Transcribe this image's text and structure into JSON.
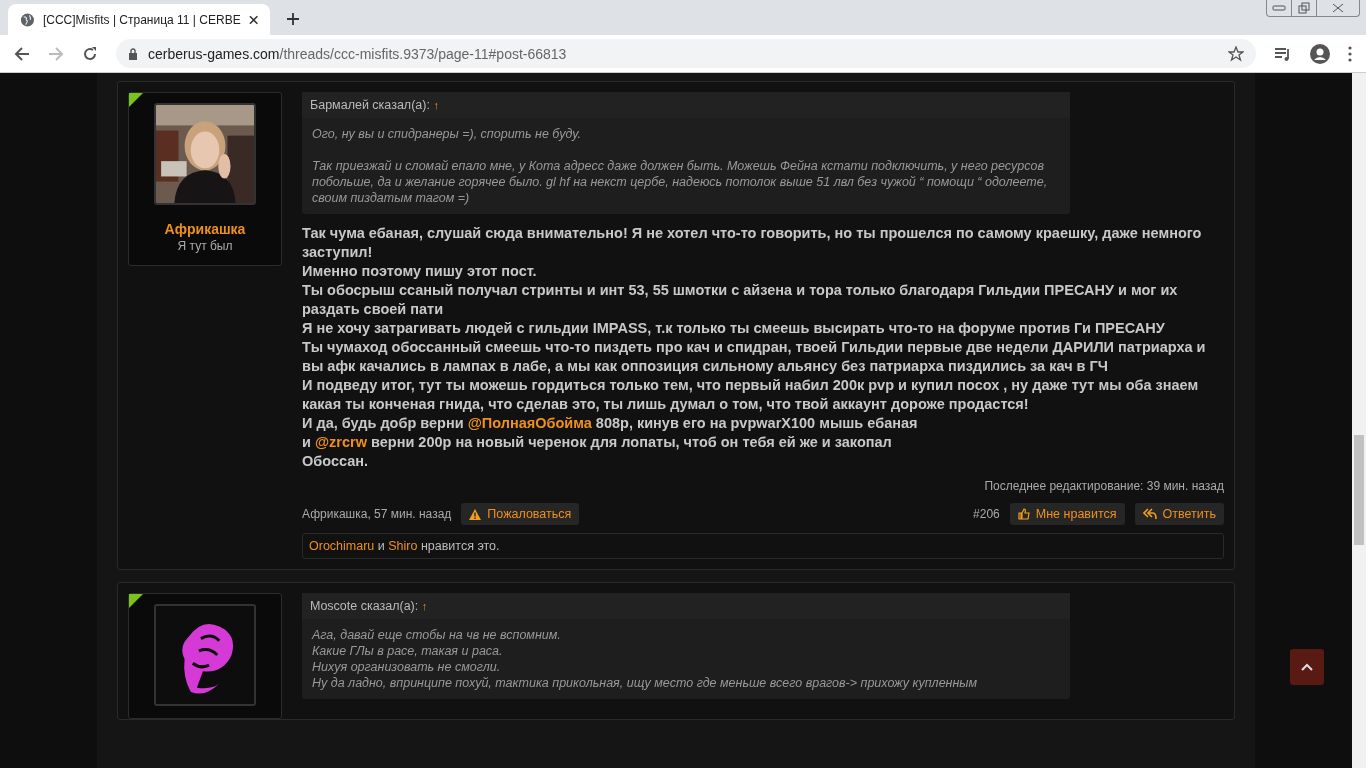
{
  "browser": {
    "tab_title": "[CCC]Misfits | Страница 11 | CERBE",
    "url_host": "cerberus-games.com",
    "url_path": "/threads/ccc-misfits.9373/page-11#post-66813"
  },
  "posts": [
    {
      "kind": "full",
      "author": "Африкашка",
      "user_title": "Я тут был",
      "avatar": {
        "kind": "picture"
      },
      "quote": {
        "author": "Бармалей сказал(а):",
        "arrow": "↑",
        "paragraphs": [
          [
            "Ого, ну вы и спидранеры =), спорить не буду."
          ],
          [
            "Так приезжай и сломай епало мне, у Кота адресс даже должен быть. Можешь Фейна кстати подключить, у него ресурсов побольше, да и желание горячее было. gl hf на некст цербе, надеюсь потолок выше 51 лвл без чужой “ помощи “ одолеете, своим пиздатым тагом =)"
          ]
        ]
      },
      "body": [
        [
          {
            "kind": "text",
            "text": "Так чума ебаная, слушай сюда внимательно! Я не хотел что-то говорить, но ты прошелся по самому краешку, даже немного заступил!"
          }
        ],
        [
          {
            "kind": "text",
            "text": "Именно поэтому пишу этот пост."
          }
        ],
        [
          {
            "kind": "text",
            "text": "Ты обосрыш ссаный получал стринты и инт 53, 55 шмотки с айзена и тора только благодаря Гильдии ПРЕСАНУ и мог их раздать своей пати"
          }
        ],
        [
          {
            "kind": "text",
            "text": "Я не хочу затрагивать людей с гильдии IMPASS, т.к только ты смеешь высирать что-то на форуме против Ги ПРЕСАНУ"
          }
        ],
        [
          {
            "kind": "text",
            "text": "Ты чумаход обоссанный смеешь что-то пиздеть про кач и спидран, твоей Гильдии первые две недели ДАРИЛИ патриарха и вы афк качались в лампах в лабе, а мы как оппозиция сильному альянсу без патриарха пиздились за кач в ГЧ"
          }
        ],
        [
          {
            "kind": "text",
            "text": "И подведу итог, тут ты можешь гордиться только тем, что первый набил 200к pvp и купил посох , ну даже тут мы оба знаем какая ты конченая гнида, что сделав это, ты лишь думал о том, что твой аккаунт дороже продастся!"
          }
        ],
        [
          {
            "kind": "text",
            "text": "И да, будь добр верни "
          },
          {
            "kind": "mention",
            "text": "@ПолнаяОбойма"
          },
          {
            "kind": "text",
            "text": " 808р, кинув его на pvpwarX100 мышь ебаная"
          }
        ],
        [
          {
            "kind": "text",
            "text": "и "
          },
          {
            "kind": "mention",
            "text": "@zrcrw"
          },
          {
            "kind": "text",
            "text": " верни 200р на новый черенок для лопаты, чтоб он тебя ей же и закопал"
          }
        ],
        [
          {
            "kind": "text",
            "text": "Обоссан."
          }
        ]
      ],
      "edited": "Последнее редактирование: 39 мин. назад",
      "meta": "Африкашка, 57 мин. назад",
      "report": "Пожаловаться",
      "number": "#206",
      "like": "Мне нравится",
      "reply": "Ответить",
      "likes": {
        "users": [
          "Orochimaru",
          "Shiro"
        ],
        "and": "и",
        "suffix": "нравится это."
      }
    },
    {
      "kind": "partial",
      "avatar": {
        "kind": "icon"
      },
      "quote": {
        "author": "Moscote сказал(а):",
        "arrow": "↑",
        "paragraphs": [
          [
            "Ага, давай еще стобы на чв не вспомним.",
            "Какие ГЛы в расе, такая и раса.",
            "Нихуя организовать не смогли.",
            "Ну да ладно, впринципе похуй, тактика прикольная, ищу место где меньше всего врагов-> прихожу купленным"
          ]
        ]
      }
    }
  ]
}
